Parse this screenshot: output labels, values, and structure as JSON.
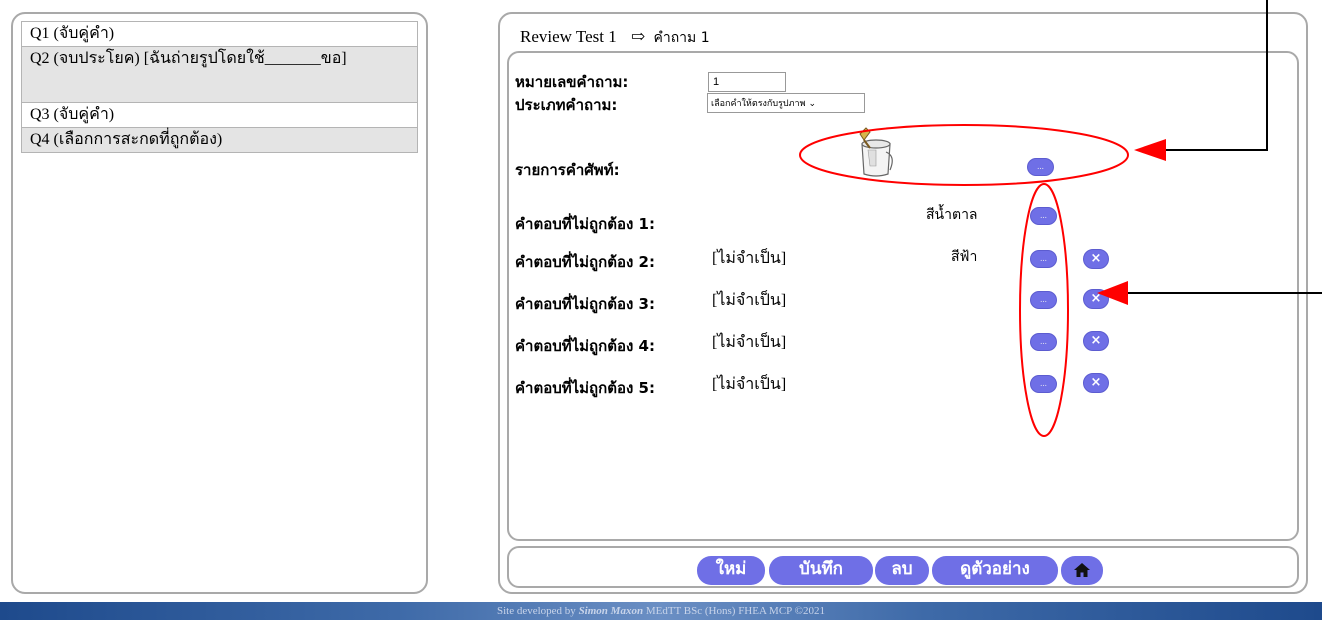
{
  "questions": [
    {
      "label": "Q1 (จับคู่คำ)"
    },
    {
      "label": "Q2 (จบประโยค) [ฉันถ่ายรูปโดยใช้_______ขอ]"
    },
    {
      "label": "Q3 (จับคู่คำ)"
    },
    {
      "label": "Q4 (เลือกการสะกดที่ถูกต้อง)"
    }
  ],
  "editor": {
    "title": "Review Test 1",
    "arrow": "⇨",
    "question_ref": "คำถาม 1",
    "number_label": "หมายเลขคำถาม:",
    "number_value": "1",
    "type_label": "ประเภทคำถาม:",
    "type_value": "เลือกคำให้ตรงกับรูปภาพ",
    "vocab_label": "รายการคำศัพท์:",
    "answers": [
      {
        "label": "คำตอบที่ไม่ถูกต้อง 1:",
        "optional": "",
        "word": "สีน้ำตาล",
        "removable": false
      },
      {
        "label": "คำตอบที่ไม่ถูกต้อง 2:",
        "optional": "[ไม่จำเป็น]",
        "word": "สีฟ้า",
        "removable": true
      },
      {
        "label": "คำตอบที่ไม่ถูกต้อง 3:",
        "optional": "[ไม่จำเป็น]",
        "word": "",
        "removable": true
      },
      {
        "label": "คำตอบที่ไม่ถูกต้อง 4:",
        "optional": "[ไม่จำเป็น]",
        "word": "",
        "removable": true
      },
      {
        "label": "คำตอบที่ไม่ถูกต้อง 5:",
        "optional": "[ไม่จำเป็น]",
        "word": "",
        "removable": true
      }
    ],
    "pick_button": "...",
    "remove_button": "×"
  },
  "toolbar": {
    "new_label": "ใหม่",
    "save_label": "บันทึก",
    "delete_label": "ลบ",
    "preview_label": "ดูตัวอย่าง"
  },
  "footer": {
    "prefix": "Site developed by",
    "name": "Simon Maxon",
    "credentials": "MEdTT  BSc (Hons)  FHEA  MCP  ©2021"
  },
  "colors": {
    "button": "#6f6fe6",
    "annotation": "#ff0000",
    "footer": "#3e6aa8"
  }
}
